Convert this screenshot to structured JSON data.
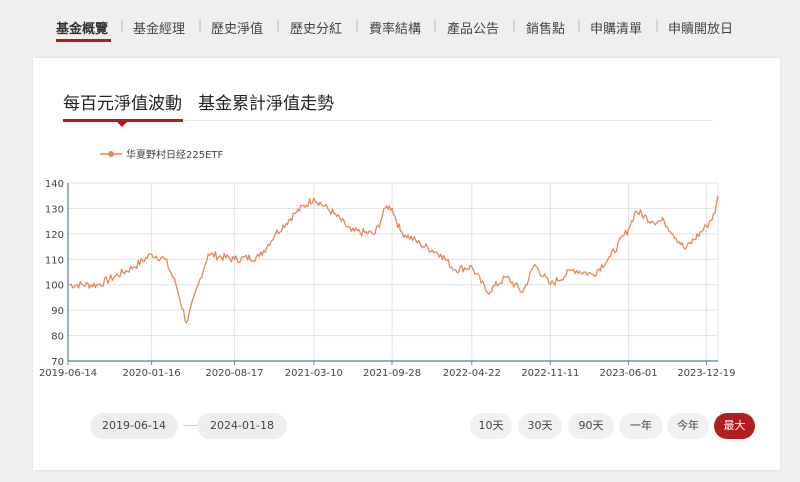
{
  "topnav": {
    "tabs": [
      {
        "label": "基金概覽",
        "active": true
      },
      {
        "label": "基金經理"
      },
      {
        "label": "歷史淨值"
      },
      {
        "label": "歷史分紅"
      },
      {
        "label": "費率結構"
      },
      {
        "label": "產品公告"
      },
      {
        "label": "銷售點"
      },
      {
        "label": "申購清單"
      },
      {
        "label": "申贖開放日"
      }
    ]
  },
  "subtabs": [
    {
      "label": "每百元淨值波動",
      "active": true
    },
    {
      "label": "基金累計淨值走勢"
    }
  ],
  "chart_data": {
    "type": "line",
    "legend_position": "top-left",
    "grid": true,
    "series": [
      {
        "name": "华夏野村日经225ETF",
        "color": "#e8875a",
        "x": [
          "2019-06-14",
          "2019-09-01",
          "2019-12-01",
          "2020-01-16",
          "2020-02-20",
          "2020-03-19",
          "2020-04-15",
          "2020-06-10",
          "2020-08-17",
          "2020-10-20",
          "2020-12-01",
          "2021-01-20",
          "2021-03-10",
          "2021-05-01",
          "2021-06-15",
          "2021-08-15",
          "2021-09-14",
          "2021-09-28",
          "2021-10-20",
          "2021-12-10",
          "2022-02-01",
          "2022-03-08",
          "2022-04-22",
          "2022-06-01",
          "2022-07-20",
          "2022-09-01",
          "2022-10-01",
          "2022-11-11",
          "2023-01-10",
          "2023-03-01",
          "2023-04-15",
          "2023-06-01",
          "2023-06-20",
          "2023-08-01",
          "2023-09-01",
          "2023-10-25",
          "2023-12-19",
          "2024-01-10",
          "2024-01-18"
        ],
        "values": [
          100,
          100,
          107,
          112,
          110,
          100,
          85,
          112,
          110,
          111,
          120,
          128,
          134,
          128,
          121,
          120,
          131,
          130,
          121,
          116,
          112,
          106,
          107,
          97,
          103,
          97,
          108,
          100,
          106,
          104,
          111,
          122,
          129,
          125,
          125,
          114,
          123,
          128,
          135
        ]
      }
    ],
    "xlabels": [
      "2019-06-14",
      "2020-01-16",
      "2020-08-17",
      "2021-03-10",
      "2021-09-28",
      "2022-04-22",
      "2022-11-11",
      "2023-06-01",
      "2023-12-19"
    ],
    "yticks": [
      70,
      80,
      90,
      100,
      110,
      120,
      130,
      140
    ],
    "ylim": [
      70,
      140
    ],
    "xlim": [
      "2019-06-14",
      "2024-01-18"
    ]
  },
  "date_range": {
    "start": "2019-06-14",
    "end": "2024-01-18"
  },
  "range_buttons": [
    {
      "label": "10天"
    },
    {
      "label": "30天"
    },
    {
      "label": "90天"
    },
    {
      "label": "一年"
    },
    {
      "label": "今年"
    },
    {
      "label": "最大",
      "active": true
    }
  ]
}
